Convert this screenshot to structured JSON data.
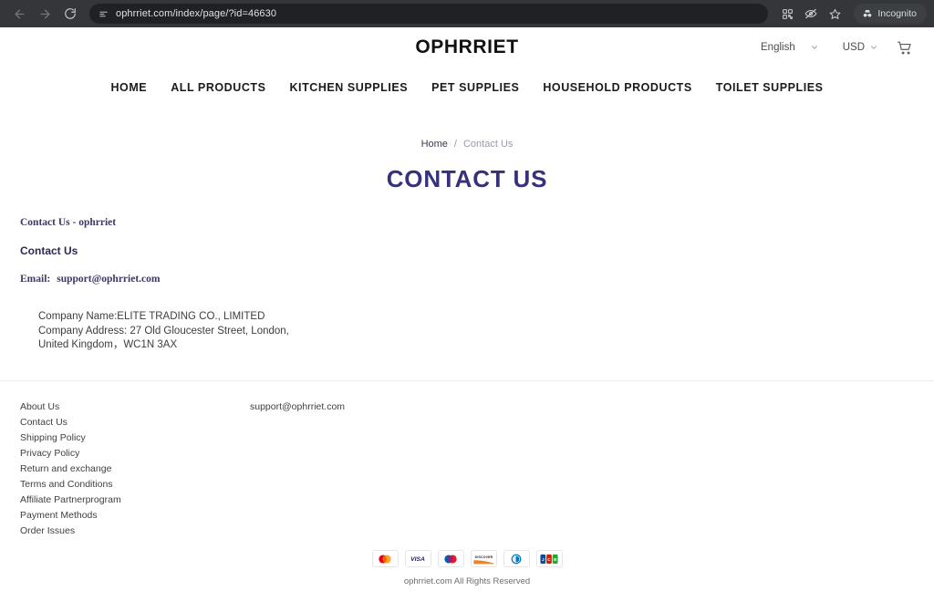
{
  "browser": {
    "url": "ophrriet.com/index/page/?id=46630",
    "back_label": "Back",
    "forward_label": "Forward",
    "reload_label": "Reload",
    "site_info_label": "View site information",
    "qr_label": "Create QR Code",
    "tracking_label": "Tracking protection",
    "bookmark_label": "Bookmark this tab",
    "incognito_label": "Incognito"
  },
  "header": {
    "logo": "OPHRRIET",
    "language": "English",
    "currency": "USD",
    "cart_label": "Cart"
  },
  "nav": {
    "items": [
      {
        "label": "HOME"
      },
      {
        "label": "ALL PRODUCTS"
      },
      {
        "label": "KITCHEN SUPPLIES"
      },
      {
        "label": "PET SUPPLIES"
      },
      {
        "label": "HOUSEHOLD PRODUCTS"
      },
      {
        "label": "TOILET SUPPLIES"
      }
    ]
  },
  "breadcrumb": {
    "home": "Home",
    "separator": "/",
    "current": "Contact Us"
  },
  "page": {
    "title": "CONTACT US"
  },
  "content": {
    "meta_line": "Contact Us - ophrriet",
    "heading": "Contact Us",
    "email_label": "Email:",
    "email_value": "support@ophrriet.com",
    "address_lines": [
      "Company Name:ELITE TRADING CO., LIMITED",
      "Company Address: 27 Old Gloucester Street, London,",
      "United Kingdom，WC1N 3AX"
    ]
  },
  "footer": {
    "links": [
      {
        "label": "About Us"
      },
      {
        "label": "Contact Us"
      },
      {
        "label": "Shipping Policy"
      },
      {
        "label": "Privacy Policy"
      },
      {
        "label": "Return and exchange"
      },
      {
        "label": "Terms and Conditions"
      },
      {
        "label": "Affiliate Partnerprogram"
      },
      {
        "label": "Payment Methods"
      },
      {
        "label": "Order Issues"
      }
    ],
    "contact_email": "support@ophrriet.com",
    "payments": [
      {
        "name": "mastercard-icon",
        "label": "Mastercard"
      },
      {
        "name": "visa-icon",
        "label": "VISA"
      },
      {
        "name": "maestro-icon",
        "label": "Maestro"
      },
      {
        "name": "discover-icon",
        "label": "DISCOVER"
      },
      {
        "name": "diners-club-icon",
        "label": "Diners Club"
      },
      {
        "name": "jcb-icon",
        "label": "JCB"
      }
    ],
    "copyright": "ophrriet.com All Rights Reserved"
  },
  "colors": {
    "title": "#35317a",
    "chrome": "#35363a",
    "omnibox": "#202124"
  }
}
